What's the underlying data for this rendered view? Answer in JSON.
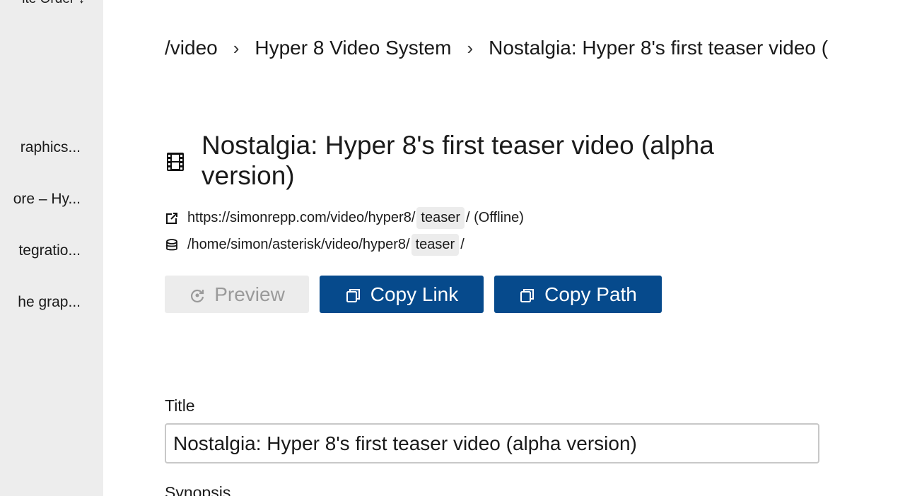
{
  "sidebar": {
    "sort_label": "ite Order ↓",
    "items": [
      {
        "label": "raphics..."
      },
      {
        "label": "ore – Hy..."
      },
      {
        "label": "tegratio..."
      },
      {
        "label": "he grap..."
      }
    ]
  },
  "breadcrumb": {
    "items": [
      "/video",
      "Hyper 8 Video System",
      "Nostalgia: Hyper 8's first teaser video ("
    ],
    "separator": "›"
  },
  "page": {
    "title": "Nostalgia: Hyper 8's first teaser video (alpha version)",
    "title_icon": "film-icon"
  },
  "links": {
    "url_prefix": "https://simonrepp.com/video/hyper8/",
    "url_segment": "teaser",
    "url_suffix": "/ (Offline)",
    "url_icon": "external-link-icon",
    "path_prefix": "/home/simon/asterisk/video/hyper8/",
    "path_segment": "teaser",
    "path_suffix": "/",
    "path_icon": "database-icon"
  },
  "actions": {
    "preview_label": "Preview",
    "copy_link_label": "Copy Link",
    "copy_path_label": "Copy Path"
  },
  "form": {
    "title_label": "Title",
    "title_value": "Nostalgia: Hyper 8's first teaser video (alpha version)",
    "synopsis_label": "Synopsis"
  },
  "colors": {
    "accent": "#064a8c",
    "sidebar_bg": "#ededed",
    "segment_bg": "#ececec"
  }
}
